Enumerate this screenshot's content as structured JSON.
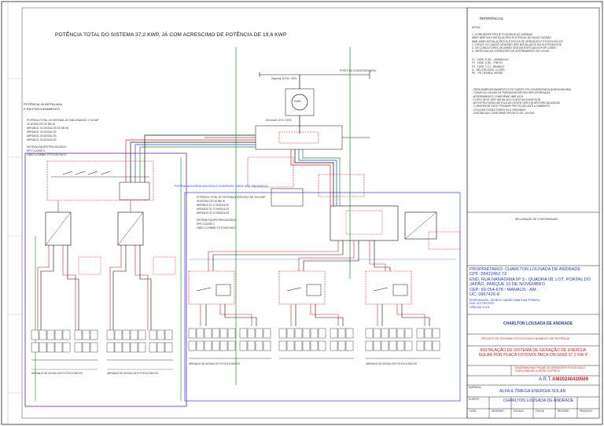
{
  "header": {
    "title": "POTÊNCIA TOTAL DO SISTEMA  37,2 KWP,  JÁ COM ACRESCIMO DE POTÊNCIA DE 19,6 KWP"
  },
  "left_notes": {
    "installed_title": "POTÊNCIA JÁ INSTALADA",
    "installed_sub": "E EM FUNCIONAMENTO",
    "installed_desc": [
      "POTÊNCIA TOTAL DO SISTEMA JÁ FUNCIONANDO 17,6 KWP",
      "32 MODULOS DE 550 W",
      "ARRANJO: 01 MODULOS DE 550 W",
      "ARRANJO: 02 MODULOS",
      "ARRANJO: 03 MODULOS",
      "ARRANJO: 04 MODULOS"
    ],
    "equip_title": "SISTEMA EQUIPOTENCIALIZADO",
    "equip_lines": [
      "DPS CLASSE II",
      "CABO 4,0 MMM2 FOTOVOLTAICO"
    ]
  },
  "new_inverter_label": "POTÊNCIA ACRESCIDA NOVO INVERSOR: 19KW (220 TRIFASICO)",
  "new_system": {
    "lines": [
      "POTÊNCIA TOTAL DO SISTEMA ACRESCIDO DE 19,6 KWP",
      "36 MODULOS DE 550 W",
      "ARRANJO 01  12 MODULOS",
      "ARRANJO 02  12 MODULOS",
      "ARRANJO 03  12 MODULOS"
    ],
    "equip_lines": [
      "SISTEMA EQUIPOTENCIALIZADO",
      "DPS CLASSE II",
      "CABO 4,0 MMM2 FOTOVOLTAICO"
    ]
  },
  "meter": {
    "label": "KWh",
    "breaker_top": "Disjuntor 3x70A / 220V",
    "breaker_mid": "50 mmm2 4X70 / 220V",
    "pole": "POSTE DA CONCESSIONÁRIA"
  },
  "bottom_labels": [
    "ARRANJO DE MODULOS FOTOVOLTAICOS",
    "ARRANJO DE MODULOS FOTOVOLTAICOS",
    "ARRANJO DE MODULOS FOTOVOLTAICOS",
    "ARRANJO DE MODULOS FOTOVOLTAICOS"
  ],
  "right_block": {
    "references_title": "REFERÊNCIAS",
    "notes_title": "NOTAS",
    "notes": [
      "1. A PRESENTE PROJETO ATENDE AS NORMAS",
      "ABNT NBR 5410 INSTALAÇÕES ELÉTRICAS DE BAIXA TENSÃO",
      "NBR 16690 INSTALAÇÕES ELÉTRICAS DE ARRANJOS FOTOVOLTAICOS",
      "2. TODOS OS CABOS DEVERÃO SER INSTALADOS EM ELETRODUTOS",
      "3. OS CONDUTORES DEVERÃO SER IDENTIFICADOS POR CORES",
      "4. VERIFICAR AS CONDIÇÕES DE ATERRAMENTO NO LOCAL"
    ],
    "colors": [
      "F1 - FASE R (R) - VERMELHO",
      "F2 - FASE S (S) - PRETO",
      "F3 - FASE T (T) - BRANCO",
      "N - NEUTRO AZUL CLARO",
      "PE - PE (TERRA) VERDE"
    ],
    "notes2": [
      "- PARA DIMENSIONAMENTO DOS CABOS FOI CONSIDERADA QUEDA MÁXIMA",
      "- TODAS AS CAIXAS DE PASSAGEM DEVEM SER ATERRADAS",
      "- ATERRAMENTO CONFORME NBR 5419",
      "- O DPS DEVE SER INSTALADO JUNTO AO INVERSOR",
      "- AS ESTRUTURAS METÁLICAS DEVEM SER EQUIPOTENCIALIZADAS",
      "- O INVERSOR DEVE POSSUIR PROTEÇÃO ANTI-ILHAMENTO",
      "- UTILIZAR CONECTORES MC4 ORIGINAIS",
      "- DISTÂNCIAS CONFORME PROJETO DE LAYOUT"
    ],
    "declaration_title": "DECLARAÇÃO DE CONFORMIDADE",
    "owner": {
      "name": "PROPRIETARIO: CHARLTON LOUSADA DE ANDRADE",
      "cpf": "CPF: 28422452-72",
      "address": "END. RUA NANAGIMA Nº 3 - QUADRA 08, LOT. PORTAL DO",
      "address2": "JAPÃO, PARQUE 10 DE NOVEMBRO",
      "cep": "CEP: 69.054-678 / MANAUS - AM.",
      "uc": "UC: 0967426-8"
    },
    "responsible": [
      "RESPONSÁVEL TÉCNICO: MAURO MANTHAS PEREIRA",
      "ENG. ELETRICISTA",
      "CREA AM 21201"
    ],
    "signature_name": "CHARLTON LOUSADA DE ANDRADE",
    "project_label": "PROJETO DE SISTEMA FOTOVOLTAICO AUMENTO DE POTÊNCIA",
    "project_title_1": "INSTALAÇÃO DE SISTEMA DE GERAÇÃO DE ENERGIA",
    "project_title_2": "SOLAR POR PLACA FOTOVOLTAICA ON-GRID  37,2  KW P",
    "subtitle_1": "DIAGRAMA MULTIFILAR DE GERADOR FOTOVOLTAICO",
    "subtitle_2": "COM CONEXÃO À REDE ELÉTRICA",
    "art_label": "A.R.T.",
    "art_number": "AM20240430569",
    "company_label": "EMPRESA",
    "company": "ALFA &  ÔMEGA  ENERGIA SOLAR",
    "client_label": "CLIENTE",
    "client": "CHARLTON LOUSADA DE ANDRADE",
    "footer_cells": [
      "DATA",
      "DESENHO",
      "ESCALA",
      "FOLHA",
      "REVISÃO",
      "PRANCHA"
    ],
    "footer_vals": [
      "",
      "",
      "",
      "",
      "",
      ""
    ]
  },
  "colors": {
    "dc_red": "#d0202a",
    "ac_green": "#1a8a3a",
    "neutral_blue": "#2a3fd0",
    "string_black": "#111111",
    "fence_purple": "#7a3fb8"
  }
}
